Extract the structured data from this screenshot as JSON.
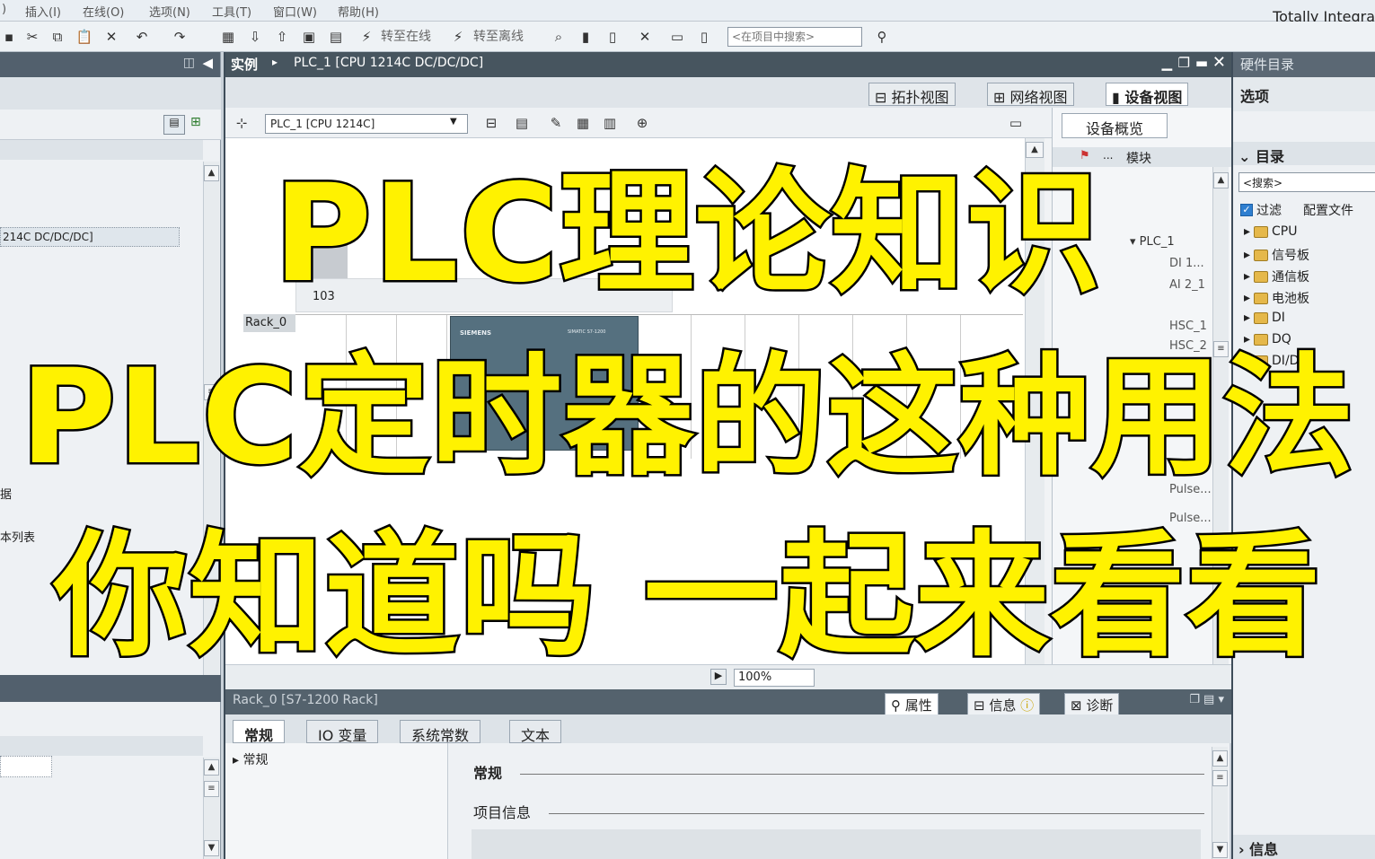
{
  "menu": {
    "items": [
      ")",
      "插入(I)",
      "在线(O)",
      "选项(N)",
      "工具(T)",
      "窗口(W)",
      "帮助(H)"
    ],
    "brand": "Totally Integra"
  },
  "toolbar": {
    "go_online": "转至在线",
    "go_offline": "转至离线",
    "search_placeholder": "<在项目中搜索>"
  },
  "left_panel": {
    "device_label": "214C DC/DC/DC]",
    "row_data": "据",
    "row_textlist": "本列表"
  },
  "editor": {
    "breadcrumb_root": "实例",
    "breadcrumb_sep": "▸",
    "breadcrumb_item": "PLC_1 [CPU 1214C DC/DC/DC]",
    "tabs": [
      "拓扑视图",
      "网络视图",
      "设备视图"
    ],
    "device_combo": "PLC_1 [CPU 1214C]",
    "rack_label": "Rack_0",
    "slot_label": "103",
    "cpu_brand": "SIEMENS",
    "cpu_model": "SIMATIC S7-1200",
    "zoom": "100%"
  },
  "overview": {
    "tab": "设备概览",
    "col_module": "模块",
    "col_dots": "...",
    "rows": [
      "PLC_1",
      "DI 1...",
      "AI 2_1",
      "HSC_1",
      "HSC_2",
      "Pulse...",
      "Pulse..."
    ]
  },
  "bottom": {
    "title": "Rack_0 [S7-1200 Rack]",
    "tabs": [
      "属性",
      "信息",
      "诊断"
    ],
    "subtabs": [
      "常规",
      "IO 变量",
      "系统常数",
      "文本"
    ],
    "tree_item": "常规",
    "section_general": "常规",
    "section_project": "项目信息"
  },
  "catalog": {
    "title": "硬件目录",
    "options": "选项",
    "directory": "目录",
    "search": "<搜索>",
    "filter": "过滤",
    "profile": "配置文件",
    "items": [
      "CPU",
      "信号板",
      "通信板",
      "电池板",
      "DI",
      "DQ",
      "DI/DQ"
    ],
    "info": "信息"
  },
  "overlay": {
    "line1": "PLC理论知识",
    "line2": "PLC定时器的这种用法",
    "line3": "你知道吗 一起来看看"
  },
  "colors": {
    "overlay_fill": "#fff200",
    "overlay_stroke": "#000000",
    "header_dark": "#47555f"
  }
}
